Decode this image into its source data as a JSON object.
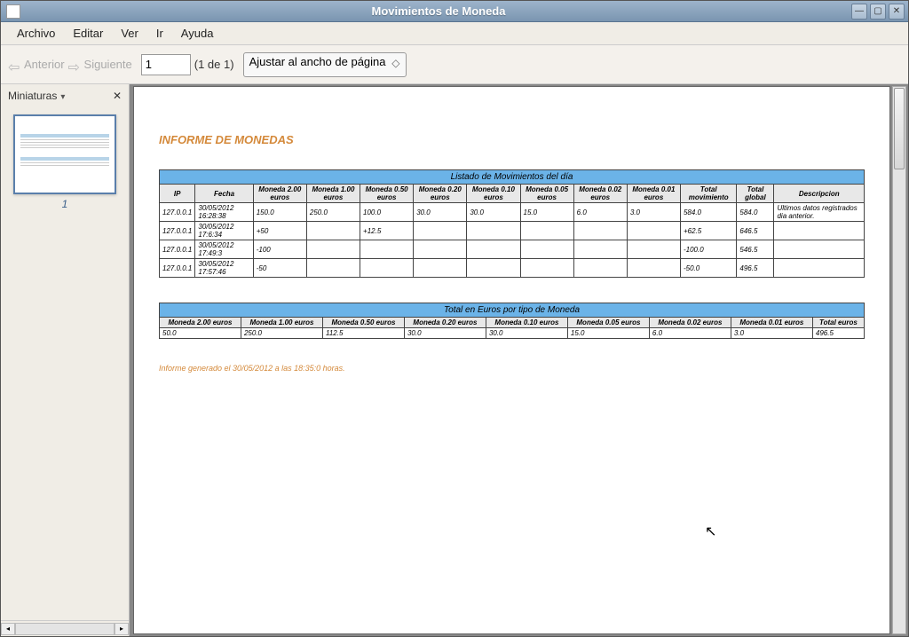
{
  "window": {
    "title": "Movimientos de Moneda"
  },
  "menu": {
    "archivo": "Archivo",
    "editar": "Editar",
    "ver": "Ver",
    "ir": "Ir",
    "ayuda": "Ayuda"
  },
  "toolbar": {
    "anterior": "Anterior",
    "siguiente": "Siguiente",
    "page_value": "1",
    "page_count": "(1 de 1)",
    "zoom": "Ajustar al ancho de página"
  },
  "sidebar": {
    "title": "Miniaturas",
    "thumb_num": "1"
  },
  "report": {
    "title": "INFORME DE MONEDAS",
    "t1_banner": "Listado de Movimientos del día",
    "t1_headers": [
      "IP",
      "Fecha",
      "Moneda 2.00 euros",
      "Moneda 1.00 euros",
      "Moneda 0.50 euros",
      "Moneda 0.20 euros",
      "Moneda 0.10 euros",
      "Moneda 0.05 euros",
      "Moneda 0.02 euros",
      "Moneda 0.01 euros",
      "Total movimiento",
      "Total global",
      "Descripcion"
    ],
    "t1_rows": [
      [
        "127.0.0.1",
        "30/05/2012 16:28:38",
        "150.0",
        "250.0",
        "100.0",
        "30.0",
        "30.0",
        "15.0",
        "6.0",
        "3.0",
        "584.0",
        "584.0",
        "Ultimos datos registrados dia anterior."
      ],
      [
        "127.0.0.1",
        "30/05/2012 17:6:34",
        "+50",
        "",
        "+12.5",
        "",
        "",
        "",
        "",
        "",
        "+62.5",
        "646.5",
        ""
      ],
      [
        "127.0.0.1",
        "30/05/2012 17:49:3",
        "-100",
        "",
        "",
        "",
        "",
        "",
        "",
        "",
        "-100.0",
        "546.5",
        ""
      ],
      [
        "127.0.0.1",
        "30/05/2012 17:57:46",
        "-50",
        "",
        "",
        "",
        "",
        "",
        "",
        "",
        "-50.0",
        "496.5",
        ""
      ]
    ],
    "t2_banner": "Total en Euros por tipo de Moneda",
    "t2_headers": [
      "Moneda 2.00 euros",
      "Moneda 1.00 euros",
      "Moneda 0.50 euros",
      "Moneda 0.20 euros",
      "Moneda 0.10 euros",
      "Moneda 0.05 euros",
      "Moneda 0.02 euros",
      "Moneda 0.01 euros",
      "Total euros"
    ],
    "t2_row": [
      "50.0",
      "250.0",
      "112.5",
      "30.0",
      "30.0",
      "15.0",
      "6.0",
      "3.0",
      "496.5"
    ],
    "footer": "Informe generado el 30/05/2012 a las 18:35:0 horas."
  }
}
